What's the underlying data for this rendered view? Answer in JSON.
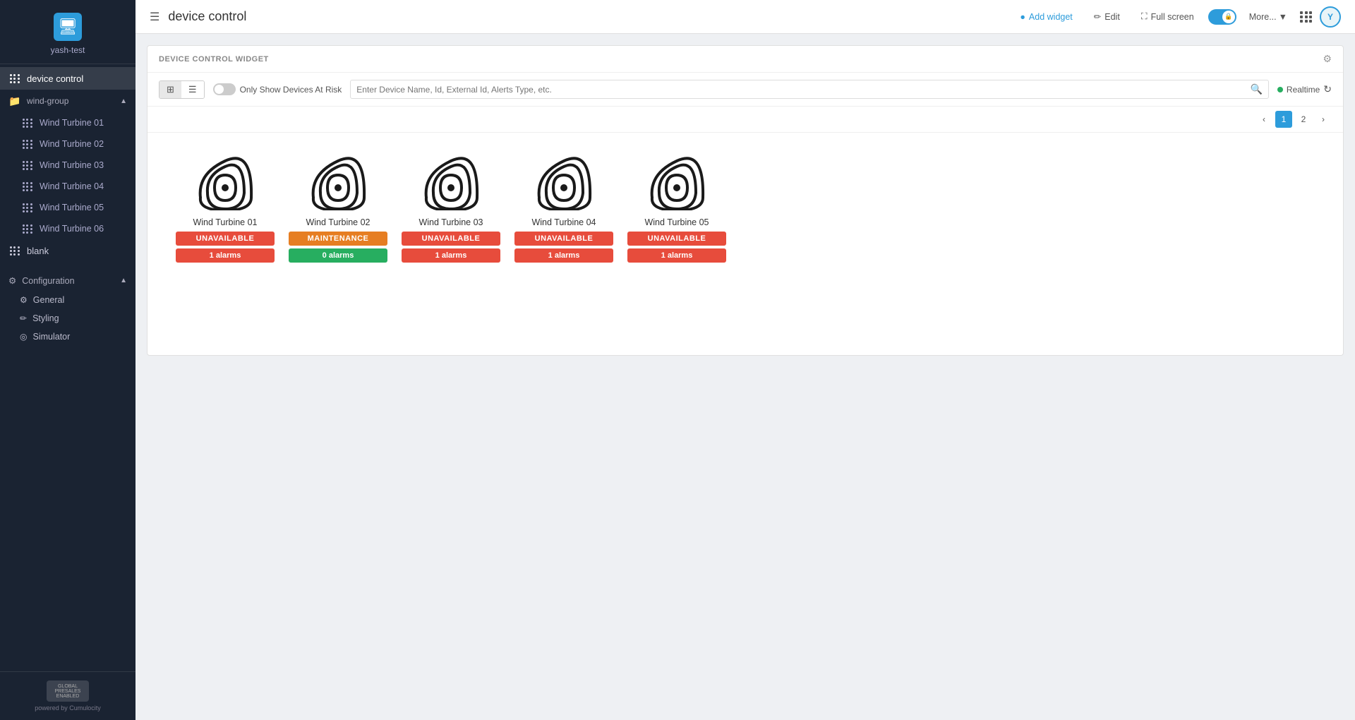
{
  "sidebar": {
    "logo_text": "yash-test",
    "logo_char": "🖥",
    "nav": {
      "device_control_label": "device control",
      "wind_group_label": "wind-group",
      "turbines": [
        {
          "label": "Wind Turbine 01"
        },
        {
          "label": "Wind Turbine 02"
        },
        {
          "label": "Wind Turbine 03"
        },
        {
          "label": "Wind Turbine 04"
        },
        {
          "label": "Wind Turbine 05"
        },
        {
          "label": "Wind Turbine 06"
        }
      ],
      "blank_label": "blank",
      "configuration_label": "Configuration",
      "config_items": [
        {
          "label": "General",
          "icon": "⚙"
        },
        {
          "label": "Styling",
          "icon": "✏"
        },
        {
          "label": "Simulator",
          "icon": "◎"
        }
      ]
    },
    "footer": {
      "badge_text": "GLOBAL PRESALES ENABLED",
      "powered_by": "powered by Cumulocity"
    }
  },
  "topbar": {
    "title": "device control",
    "add_widget_label": "Add widget",
    "edit_label": "Edit",
    "full_screen_label": "Full screen",
    "more_label": "More...",
    "user_initial": "Y"
  },
  "widget": {
    "header_title": "DEVICE CONTROL WIDGET",
    "toolbar": {
      "only_risk_label": "Only Show Devices At Risk",
      "search_placeholder": "Enter Device Name, Id, External Id, Alerts Type, etc.",
      "realtime_label": "Realtime"
    },
    "pagination": {
      "current": 1,
      "total": 2
    },
    "devices": [
      {
        "name": "Wind Turbine 01",
        "status": "UNAVAILABLE",
        "status_type": "unavailable",
        "alarms": "1 alarms",
        "alarm_type": "red"
      },
      {
        "name": "Wind Turbine 02",
        "status": "MAINTENANCE",
        "status_type": "maintenance",
        "alarms": "0 alarms",
        "alarm_type": "green"
      },
      {
        "name": "Wind Turbine 03",
        "status": "UNAVAILABLE",
        "status_type": "unavailable",
        "alarms": "1 alarms",
        "alarm_type": "red"
      },
      {
        "name": "Wind Turbine 04",
        "status": "UNAVAILABLE",
        "status_type": "unavailable",
        "alarms": "1 alarms",
        "alarm_type": "red"
      },
      {
        "name": "Wind Turbine 05",
        "status": "UNAVAILABLE",
        "status_type": "unavailable",
        "alarms": "1 alarms",
        "alarm_type": "red"
      }
    ]
  }
}
